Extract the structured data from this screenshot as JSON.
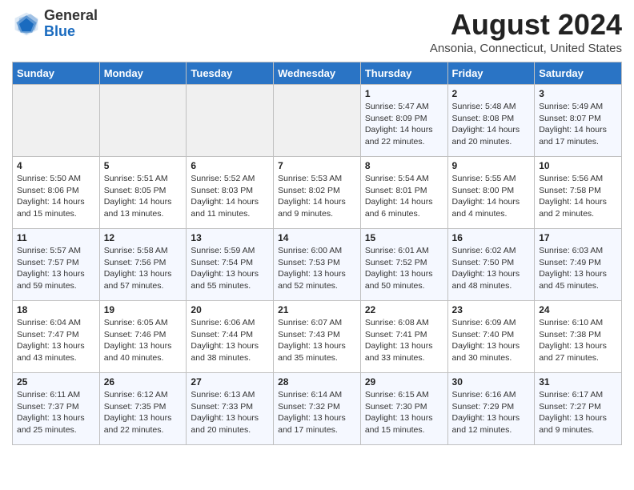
{
  "header": {
    "logo_line1": "General",
    "logo_line2": "Blue",
    "month_year": "August 2024",
    "location": "Ansonia, Connecticut, United States"
  },
  "weekdays": [
    "Sunday",
    "Monday",
    "Tuesday",
    "Wednesday",
    "Thursday",
    "Friday",
    "Saturday"
  ],
  "weeks": [
    [
      {
        "day": "",
        "info": ""
      },
      {
        "day": "",
        "info": ""
      },
      {
        "day": "",
        "info": ""
      },
      {
        "day": "",
        "info": ""
      },
      {
        "day": "1",
        "info": "Sunrise: 5:47 AM\nSunset: 8:09 PM\nDaylight: 14 hours\nand 22 minutes."
      },
      {
        "day": "2",
        "info": "Sunrise: 5:48 AM\nSunset: 8:08 PM\nDaylight: 14 hours\nand 20 minutes."
      },
      {
        "day": "3",
        "info": "Sunrise: 5:49 AM\nSunset: 8:07 PM\nDaylight: 14 hours\nand 17 minutes."
      }
    ],
    [
      {
        "day": "4",
        "info": "Sunrise: 5:50 AM\nSunset: 8:06 PM\nDaylight: 14 hours\nand 15 minutes."
      },
      {
        "day": "5",
        "info": "Sunrise: 5:51 AM\nSunset: 8:05 PM\nDaylight: 14 hours\nand 13 minutes."
      },
      {
        "day": "6",
        "info": "Sunrise: 5:52 AM\nSunset: 8:03 PM\nDaylight: 14 hours\nand 11 minutes."
      },
      {
        "day": "7",
        "info": "Sunrise: 5:53 AM\nSunset: 8:02 PM\nDaylight: 14 hours\nand 9 minutes."
      },
      {
        "day": "8",
        "info": "Sunrise: 5:54 AM\nSunset: 8:01 PM\nDaylight: 14 hours\nand 6 minutes."
      },
      {
        "day": "9",
        "info": "Sunrise: 5:55 AM\nSunset: 8:00 PM\nDaylight: 14 hours\nand 4 minutes."
      },
      {
        "day": "10",
        "info": "Sunrise: 5:56 AM\nSunset: 7:58 PM\nDaylight: 14 hours\nand 2 minutes."
      }
    ],
    [
      {
        "day": "11",
        "info": "Sunrise: 5:57 AM\nSunset: 7:57 PM\nDaylight: 13 hours\nand 59 minutes."
      },
      {
        "day": "12",
        "info": "Sunrise: 5:58 AM\nSunset: 7:56 PM\nDaylight: 13 hours\nand 57 minutes."
      },
      {
        "day": "13",
        "info": "Sunrise: 5:59 AM\nSunset: 7:54 PM\nDaylight: 13 hours\nand 55 minutes."
      },
      {
        "day": "14",
        "info": "Sunrise: 6:00 AM\nSunset: 7:53 PM\nDaylight: 13 hours\nand 52 minutes."
      },
      {
        "day": "15",
        "info": "Sunrise: 6:01 AM\nSunset: 7:52 PM\nDaylight: 13 hours\nand 50 minutes."
      },
      {
        "day": "16",
        "info": "Sunrise: 6:02 AM\nSunset: 7:50 PM\nDaylight: 13 hours\nand 48 minutes."
      },
      {
        "day": "17",
        "info": "Sunrise: 6:03 AM\nSunset: 7:49 PM\nDaylight: 13 hours\nand 45 minutes."
      }
    ],
    [
      {
        "day": "18",
        "info": "Sunrise: 6:04 AM\nSunset: 7:47 PM\nDaylight: 13 hours\nand 43 minutes."
      },
      {
        "day": "19",
        "info": "Sunrise: 6:05 AM\nSunset: 7:46 PM\nDaylight: 13 hours\nand 40 minutes."
      },
      {
        "day": "20",
        "info": "Sunrise: 6:06 AM\nSunset: 7:44 PM\nDaylight: 13 hours\nand 38 minutes."
      },
      {
        "day": "21",
        "info": "Sunrise: 6:07 AM\nSunset: 7:43 PM\nDaylight: 13 hours\nand 35 minutes."
      },
      {
        "day": "22",
        "info": "Sunrise: 6:08 AM\nSunset: 7:41 PM\nDaylight: 13 hours\nand 33 minutes."
      },
      {
        "day": "23",
        "info": "Sunrise: 6:09 AM\nSunset: 7:40 PM\nDaylight: 13 hours\nand 30 minutes."
      },
      {
        "day": "24",
        "info": "Sunrise: 6:10 AM\nSunset: 7:38 PM\nDaylight: 13 hours\nand 27 minutes."
      }
    ],
    [
      {
        "day": "25",
        "info": "Sunrise: 6:11 AM\nSunset: 7:37 PM\nDaylight: 13 hours\nand 25 minutes."
      },
      {
        "day": "26",
        "info": "Sunrise: 6:12 AM\nSunset: 7:35 PM\nDaylight: 13 hours\nand 22 minutes."
      },
      {
        "day": "27",
        "info": "Sunrise: 6:13 AM\nSunset: 7:33 PM\nDaylight: 13 hours\nand 20 minutes."
      },
      {
        "day": "28",
        "info": "Sunrise: 6:14 AM\nSunset: 7:32 PM\nDaylight: 13 hours\nand 17 minutes."
      },
      {
        "day": "29",
        "info": "Sunrise: 6:15 AM\nSunset: 7:30 PM\nDaylight: 13 hours\nand 15 minutes."
      },
      {
        "day": "30",
        "info": "Sunrise: 6:16 AM\nSunset: 7:29 PM\nDaylight: 13 hours\nand 12 minutes."
      },
      {
        "day": "31",
        "info": "Sunrise: 6:17 AM\nSunset: 7:27 PM\nDaylight: 13 hours\nand 9 minutes."
      }
    ]
  ]
}
